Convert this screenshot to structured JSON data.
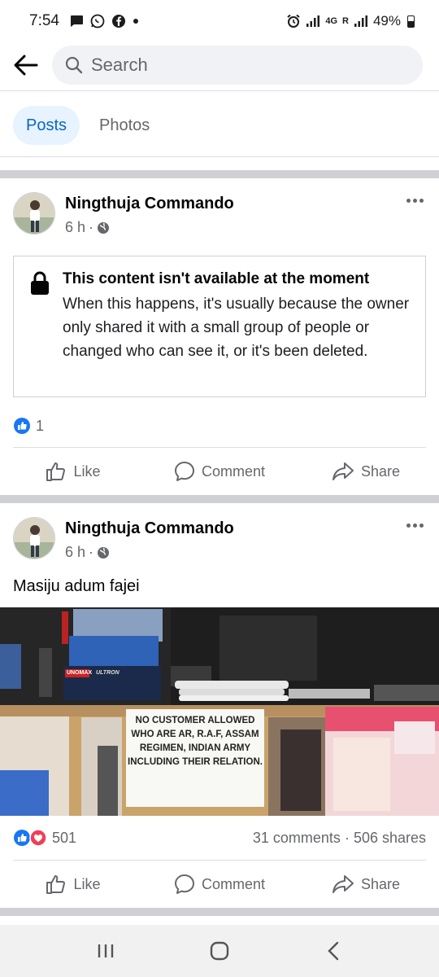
{
  "status_bar": {
    "time": "7:54",
    "network": "4G",
    "roaming": "R",
    "battery": "49%",
    "icons": [
      "message-icon",
      "whatsapp-icon",
      "facebook-icon",
      "dot-icon",
      "alarm-icon",
      "signal-icon",
      "signal-icon",
      "battery-icon"
    ]
  },
  "header": {
    "search_placeholder": "Search",
    "icons": [
      "back-arrow-icon",
      "search-icon"
    ]
  },
  "tabs": [
    {
      "label": "Posts",
      "active": true
    },
    {
      "label": "Photos",
      "active": false
    }
  ],
  "posts": [
    {
      "author": "Ningthuja Commando",
      "time": "6 h",
      "unavailable": {
        "title": "This content isn't available at the moment",
        "body": "When this happens, it's usually because the owner only shared it with a small group of people or changed who can see it, or it's been deleted."
      },
      "reaction_count": "1",
      "actions": {
        "like": "Like",
        "comment": "Comment",
        "share": "Share"
      }
    },
    {
      "author": "Ningthuja Commando",
      "time": "6 h",
      "caption": "Masiju adum fajei",
      "photo_notice": "NO CUSTOMER ALLOWED WHO ARE AR, R.A.F, ASSAM REGIMEN, INDIAN ARMY INCLUDING THEIR RELATION.",
      "photo_text": {
        "box_brand": "UNOMAX",
        "box_model": "ULTRON"
      },
      "reaction_count": "501",
      "comments": "31 comments",
      "shares": "506 shares",
      "actions": {
        "like": "Like",
        "comment": "Comment",
        "share": "Share"
      }
    }
  ],
  "colors": {
    "accent": "#0a66c2",
    "like_blue": "#1877f2",
    "love_red": "#f33e58",
    "divider": "#ced0d4"
  }
}
